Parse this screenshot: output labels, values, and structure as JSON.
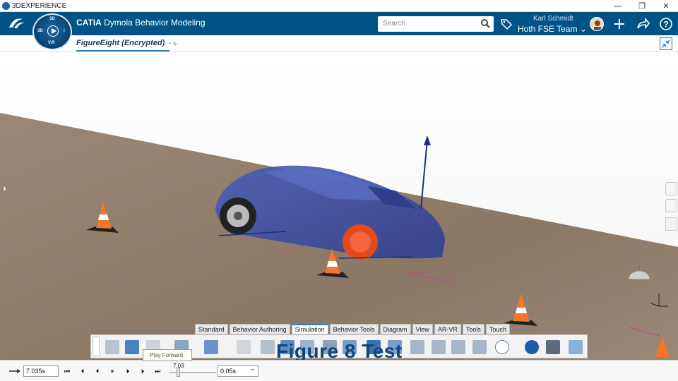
{
  "titlebar": {
    "title": "3DEXPERIENCE",
    "controls": [
      "—",
      "❐",
      "✕"
    ]
  },
  "header": {
    "brand": "CATIA",
    "app_name": "Dymola Behavior Modeling",
    "compass": {
      "top": "3D",
      "left": "3D",
      "bottom": "V.R",
      "right": "i"
    },
    "search": {
      "placeholder": "Search"
    },
    "user": {
      "name": "Karl Schmidt",
      "team": "Hoth FSE Team ⌄"
    },
    "icons": [
      "tag-icon",
      "add-icon",
      "share-icon",
      "help-icon"
    ]
  },
  "tabs": {
    "active_tab": "FigureEight (Encrypted)",
    "tab_menu": "-",
    "add": "+"
  },
  "command_tabs": [
    "Standard",
    "Behavior Authoring",
    "Simulation",
    "Behavior Tools",
    "Diagram",
    "View",
    "AR-VR",
    "Tools",
    "Touch"
  ],
  "active_command_tab": "Simulation",
  "overlay": {
    "title": "Figure 8 Test"
  },
  "player": {
    "current_time": "7.035s",
    "slider_value": "7.03",
    "step": "0.05s",
    "tooltip": "Play Forward"
  },
  "colors": {
    "header_blue": "#005386",
    "accent": "#2e7fc4",
    "ground": "#8e7b69",
    "car": "#3a4fa6",
    "wheel_highlight": "#e24a1c",
    "cone": "#f0772b"
  }
}
